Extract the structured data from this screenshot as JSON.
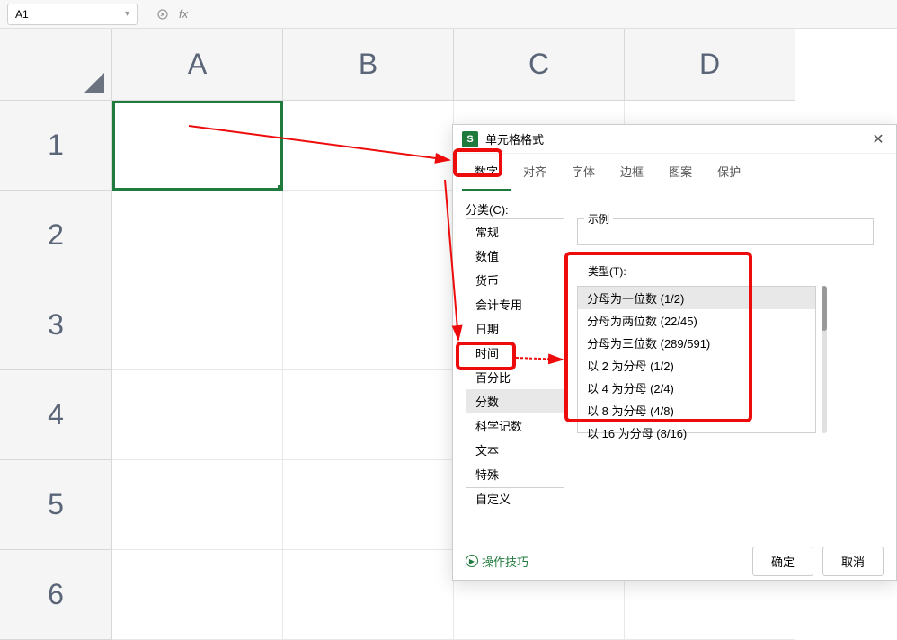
{
  "nameBox": {
    "value": "A1"
  },
  "fx": {
    "label": "fx"
  },
  "columns": [
    "A",
    "B",
    "C",
    "D"
  ],
  "rows": [
    "1",
    "2",
    "3",
    "4",
    "5",
    "6"
  ],
  "dialog": {
    "title": "单元格格式",
    "tabs": [
      "数字",
      "对齐",
      "字体",
      "边框",
      "图案",
      "保护"
    ],
    "categoryLabel": "分类(C):",
    "categories": [
      "常规",
      "数值",
      "货币",
      "会计专用",
      "日期",
      "时间",
      "百分比",
      "分数",
      "科学记数",
      "文本",
      "特殊",
      "自定义"
    ],
    "sampleLabel": "示例",
    "typeLabel": "类型(T):",
    "types": [
      "分母为一位数 (1/2)",
      "分母为两位数 (22/45)",
      "分母为三位数 (289/591)",
      "以 2 为分母 (1/2)",
      "以 4 为分母 (2/4)",
      "以 8 为分母 (4/8)",
      "以 16 为分母 (8/16)"
    ],
    "tipsLabel": "操作技巧",
    "okLabel": "确定",
    "cancelLabel": "取消"
  }
}
